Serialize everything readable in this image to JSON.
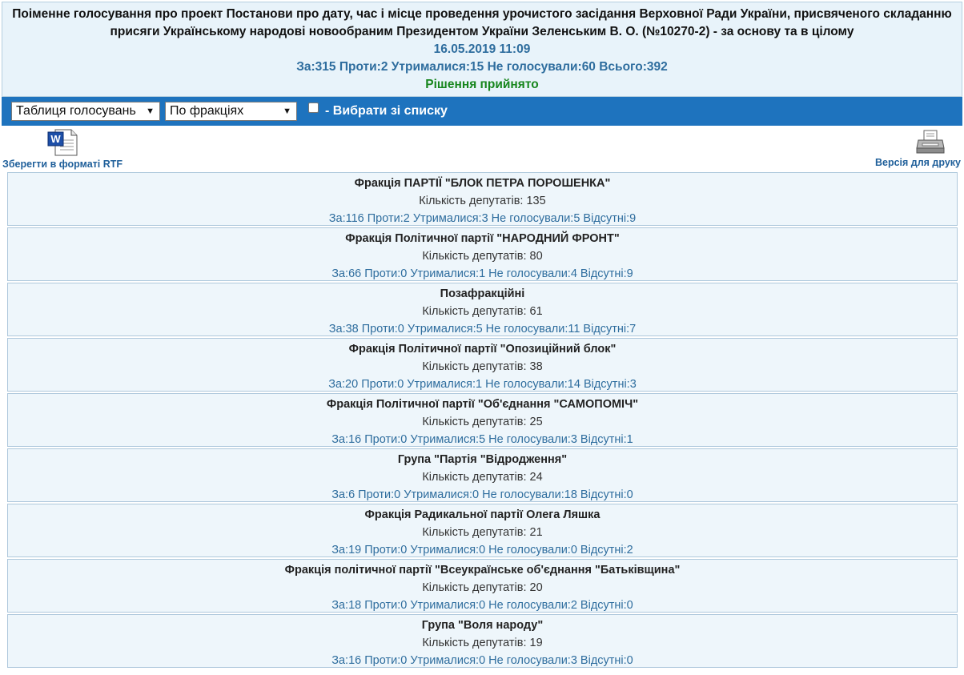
{
  "header": {
    "title": "Поіменне голосування про проект Постанови про дату, час і місце проведення урочистого засідання Верховної Ради України, присвяченого складанню присяги Українському народові новообраним Президентом України Зеленським В. О. (№10270-2) - за основу та в цілому",
    "datetime": "16.05.2019 11:09",
    "totals": "За:315 Проти:2 Утрималися:15 Не голосували:60 Всього:392",
    "decision": "Рішення прийнято",
    "decision_color": "#17861d"
  },
  "toolbar": {
    "view_select": "Таблиця голосувань",
    "group_select": "По фракціях",
    "choose_label": "- Вибрати зі списку",
    "bg_color": "#1e73be"
  },
  "tools": {
    "rtf_label": "Зберегти в форматі RTF",
    "rtf_icon": "word-document-icon",
    "print_label": "Версія для друку",
    "print_icon": "printer-icon"
  },
  "factions": [
    {
      "name": "Фракція ПАРТІЇ \"БЛОК ПЕТРА ПОРОШЕНКА\"",
      "count": "Кількість депутатів: 135",
      "votes": "За:116 Проти:2 Утрималися:3 Не голосували:5 Відсутні:9"
    },
    {
      "name": "Фракція Політичної партії \"НАРОДНИЙ ФРОНТ\"",
      "count": "Кількість депутатів: 80",
      "votes": "За:66 Проти:0 Утрималися:1 Не голосували:4 Відсутні:9"
    },
    {
      "name": "Позафракційні",
      "count": "Кількість депутатів: 61",
      "votes": "За:38 Проти:0 Утрималися:5 Не голосували:11 Відсутні:7"
    },
    {
      "name": "Фракція Політичної партії \"Опозиційний блок\"",
      "count": "Кількість депутатів: 38",
      "votes": "За:20 Проти:0 Утрималися:1 Не голосували:14 Відсутні:3"
    },
    {
      "name": "Фракція Політичної партії \"Об'єднання \"САМОПОМІЧ\"",
      "count": "Кількість депутатів: 25",
      "votes": "За:16 Проти:0 Утрималися:5 Не голосували:3 Відсутні:1"
    },
    {
      "name": "Група \"Партія \"Відродження\"",
      "count": "Кількість депутатів: 24",
      "votes": "За:6 Проти:0 Утрималися:0 Не голосували:18 Відсутні:0"
    },
    {
      "name": "Фракція Радикальної партії Олега Ляшка",
      "count": "Кількість депутатів: 21",
      "votes": "За:19 Проти:0 Утрималися:0 Не голосували:0 Відсутні:2"
    },
    {
      "name": "Фракція політичної партії \"Всеукраїнське об'єднання \"Батьківщина\"",
      "count": "Кількість депутатів: 20",
      "votes": "За:18 Проти:0 Утрималися:0 Не голосували:2 Відсутні:0"
    },
    {
      "name": "Група \"Воля народу\"",
      "count": "Кількість депутатів: 19",
      "votes": "За:16 Проти:0 Утрималися:0 Не голосували:3 Відсутні:0"
    }
  ]
}
